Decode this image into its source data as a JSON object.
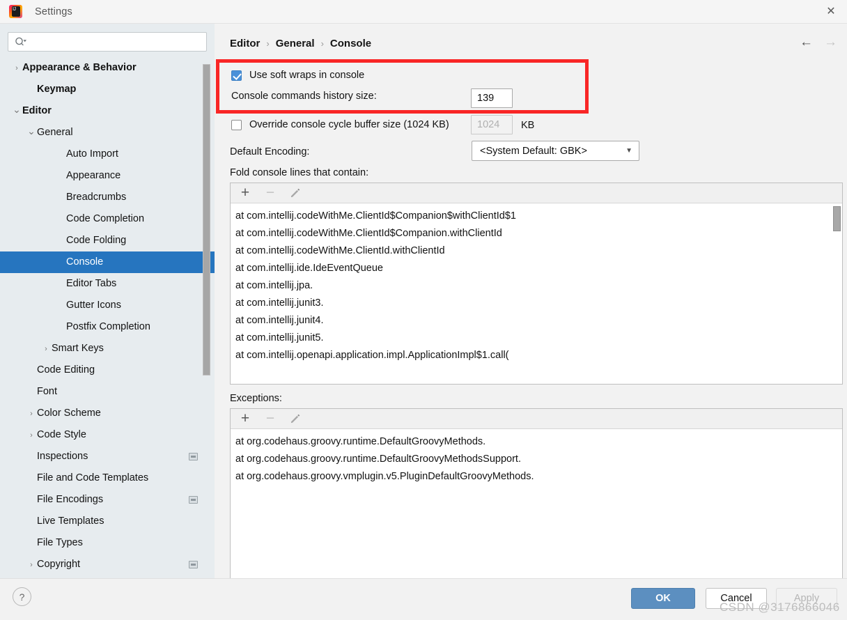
{
  "window": {
    "title": "Settings",
    "logo_text": "IJ",
    "close_label": "✕"
  },
  "sidebar": {
    "search": {
      "value": "",
      "placeholder": ""
    },
    "items": [
      {
        "label": "Appearance & Behavior",
        "indent": 0,
        "chevron": "collapsed",
        "bold": true,
        "selected": false,
        "badge": false
      },
      {
        "label": "Keymap",
        "indent": 1,
        "chevron": "none",
        "bold": true,
        "selected": false,
        "badge": false
      },
      {
        "label": "Editor",
        "indent": 0,
        "chevron": "expanded",
        "bold": true,
        "selected": false,
        "badge": false
      },
      {
        "label": "General",
        "indent": 1,
        "chevron": "expanded",
        "bold": false,
        "selected": false,
        "badge": false
      },
      {
        "label": "Auto Import",
        "indent": 3,
        "chevron": "none",
        "bold": false,
        "selected": false,
        "badge": false
      },
      {
        "label": "Appearance",
        "indent": 3,
        "chevron": "none",
        "bold": false,
        "selected": false,
        "badge": false
      },
      {
        "label": "Breadcrumbs",
        "indent": 3,
        "chevron": "none",
        "bold": false,
        "selected": false,
        "badge": false
      },
      {
        "label": "Code Completion",
        "indent": 3,
        "chevron": "none",
        "bold": false,
        "selected": false,
        "badge": false
      },
      {
        "label": "Code Folding",
        "indent": 3,
        "chevron": "none",
        "bold": false,
        "selected": false,
        "badge": false
      },
      {
        "label": "Console",
        "indent": 3,
        "chevron": "none",
        "bold": false,
        "selected": true,
        "badge": false
      },
      {
        "label": "Editor Tabs",
        "indent": 3,
        "chevron": "none",
        "bold": false,
        "selected": false,
        "badge": false
      },
      {
        "label": "Gutter Icons",
        "indent": 3,
        "chevron": "none",
        "bold": false,
        "selected": false,
        "badge": false
      },
      {
        "label": "Postfix Completion",
        "indent": 3,
        "chevron": "none",
        "bold": false,
        "selected": false,
        "badge": false
      },
      {
        "label": "Smart Keys",
        "indent": 2,
        "chevron": "collapsed",
        "bold": false,
        "selected": false,
        "badge": false
      },
      {
        "label": "Code Editing",
        "indent": 1,
        "chevron": "none",
        "bold": false,
        "selected": false,
        "badge": false
      },
      {
        "label": "Font",
        "indent": 1,
        "chevron": "none",
        "bold": false,
        "selected": false,
        "badge": false
      },
      {
        "label": "Color Scheme",
        "indent": 1,
        "chevron": "collapsed",
        "bold": false,
        "selected": false,
        "badge": false
      },
      {
        "label": "Code Style",
        "indent": 1,
        "chevron": "collapsed",
        "bold": false,
        "selected": false,
        "badge": false
      },
      {
        "label": "Inspections",
        "indent": 1,
        "chevron": "none",
        "bold": false,
        "selected": false,
        "badge": true
      },
      {
        "label": "File and Code Templates",
        "indent": 1,
        "chevron": "none",
        "bold": false,
        "selected": false,
        "badge": false
      },
      {
        "label": "File Encodings",
        "indent": 1,
        "chevron": "none",
        "bold": false,
        "selected": false,
        "badge": true
      },
      {
        "label": "Live Templates",
        "indent": 1,
        "chevron": "none",
        "bold": false,
        "selected": false,
        "badge": false
      },
      {
        "label": "File Types",
        "indent": 1,
        "chevron": "none",
        "bold": false,
        "selected": false,
        "badge": false
      },
      {
        "label": "Copyright",
        "indent": 1,
        "chevron": "collapsed",
        "bold": false,
        "selected": false,
        "badge": true
      }
    ]
  },
  "content": {
    "breadcrumb": {
      "part1": "Editor",
      "part2": "General",
      "part3": "Console",
      "separator": "›"
    },
    "nav": {
      "back": "←",
      "forward": "→"
    },
    "soft_wraps": {
      "label": "Use soft wraps in console",
      "checked": true
    },
    "history_size": {
      "label": "Console commands history size:",
      "value": "139"
    },
    "override_buffer": {
      "label": "Override console cycle buffer size (1024 KB)",
      "checked": false,
      "value": "1024",
      "unit": "KB"
    },
    "default_encoding": {
      "label": "Default Encoding:",
      "value": "<System Default: GBK>",
      "caret": "▼"
    },
    "fold_section": {
      "label": "Fold console lines that contain:",
      "toolbar": {
        "add": "+",
        "remove": "−",
        "edit": "edit-pencil-icon"
      },
      "items": [
        "at com.intellij.codeWithMe.ClientId$Companion$withClientId$1",
        "at com.intellij.codeWithMe.ClientId$Companion.withClientId",
        "at com.intellij.codeWithMe.ClientId.withClientId",
        "at com.intellij.ide.IdeEventQueue",
        "at com.intellij.jpa.",
        "at com.intellij.junit3.",
        "at com.intellij.junit4.",
        "at com.intellij.junit5.",
        "at com.intellij.openapi.application.impl.ApplicationImpl$1.call("
      ]
    },
    "exceptions_section": {
      "label": "Exceptions:",
      "toolbar": {
        "add": "+",
        "remove": "−",
        "edit": "edit-pencil-icon"
      },
      "items": [
        "at org.codehaus.groovy.runtime.DefaultGroovyMethods.",
        "at org.codehaus.groovy.runtime.DefaultGroovyMethodsSupport.",
        "at org.codehaus.groovy.vmplugin.v5.PluginDefaultGroovyMethods."
      ]
    }
  },
  "footer": {
    "help": "?",
    "ok": "OK",
    "cancel": "Cancel",
    "apply": "Apply",
    "watermark": "CSDN @3176866046"
  },
  "colors": {
    "selection": "#2675bf",
    "highlight_box": "#f92626",
    "primary_button": "#5c8fc0",
    "checkbox_checked": "#4a90d9"
  }
}
